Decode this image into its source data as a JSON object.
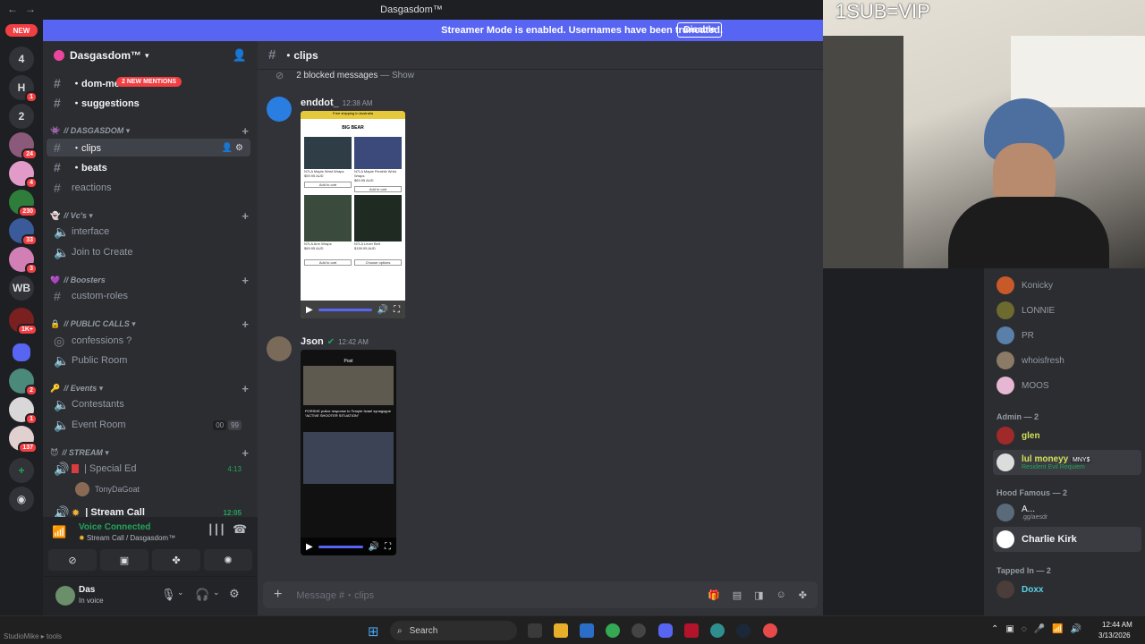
{
  "window": {
    "title": "Dasgasdom™"
  },
  "banner": {
    "text": "Streamer Mode is enabled. Usernames have been truncated.",
    "button": "Disable"
  },
  "rail": {
    "new_label": "NEW",
    "items": [
      {
        "label": "4"
      },
      {
        "label": "H",
        "badge": "1"
      },
      {
        "label": "2"
      },
      {
        "label": "",
        "badge": "24"
      },
      {
        "label": "",
        "badge": "4"
      },
      {
        "label": "",
        "badge": "230"
      },
      {
        "label": "",
        "badge": "33"
      },
      {
        "label": "",
        "badge": "3"
      },
      {
        "label": "WB"
      },
      {
        "label": "",
        "badge": "1K+"
      },
      {
        "label": ""
      },
      {
        "label": "",
        "badge": "2"
      },
      {
        "label": "",
        "badge": "1"
      },
      {
        "label": "",
        "badge": "137"
      }
    ]
  },
  "guild": {
    "name": "Dasgasdom™"
  },
  "channels": {
    "top": [
      {
        "name": "・dom-med"
      },
      {
        "name": "・suggestions"
      }
    ],
    "mention_pill": "2 NEW MENTIONS",
    "cat_dasgasdom": "// DASGASDOM",
    "dasgasdom": [
      {
        "name": "・clips"
      },
      {
        "name": "・beats"
      },
      {
        "name": "reactions"
      }
    ],
    "cat_vcs": "// Vc's",
    "vcs": [
      {
        "name": "interface"
      },
      {
        "name": "Join to Create"
      }
    ],
    "cat_boosters": "// Boosters",
    "boosters": [
      {
        "name": "custom-roles"
      }
    ],
    "cat_public": "// PUBLIC CALLS",
    "public": [
      {
        "name": "confessions ?"
      },
      {
        "name": "Public Room"
      }
    ],
    "cat_events": "// Events",
    "events": [
      {
        "name": "Contestants"
      },
      {
        "name": "Event Room",
        "counts": [
          "00",
          "99"
        ]
      }
    ],
    "cat_stream": "// STREAM",
    "stream": [
      {
        "name": "| Special Ed",
        "time": "4:13"
      },
      {
        "name": "TonyDaGoat"
      },
      {
        "name": "| Stream Call",
        "time": "12:05"
      }
    ]
  },
  "voice": {
    "status": "Voice Connected",
    "location": "Stream Call / Dasgasdom™"
  },
  "user": {
    "name": "Das",
    "status": "In voice"
  },
  "chat": {
    "channel": "・clips",
    "blocked": "2 blocked messages",
    "blocked_show": "— Show",
    "messages": [
      {
        "author": "enddot_",
        "time": "12:38 AM",
        "video_header": "Free shipping in Australia",
        "video_brand": "BIG BEAR",
        "products": [
          {
            "name": "N7LA Maple Wrist Wraps",
            "price": "$59.95 AUD",
            "btn": "Add to cart"
          },
          {
            "name": "N7LA Maple Flexible Wrist Wraps",
            "price": "$69.95 AUD",
            "btn": "Add to cart"
          },
          {
            "name": "N7LA Arm Wraps",
            "price": "$69.95 AUD",
            "btn": "Add to cart"
          },
          {
            "name": "N7LA Lever Belt",
            "price": "$159.95 AUD",
            "btn": "Choose options"
          }
        ]
      },
      {
        "author": "Json",
        "time": "12:42 AM",
        "video_header": "Post",
        "video_caption": "PORSHE police response to Temple Israel synagogue “ACTIVE SHOOTER SITUATION”"
      }
    ],
    "composer_placeholder": "Message #・clips"
  },
  "cam": {
    "overlay": "1SUB=VIP"
  },
  "members": {
    "online": [
      {
        "name": "Konicky"
      },
      {
        "name": "LONNIE"
      },
      {
        "name": "PR"
      },
      {
        "name": "whoisfresh"
      },
      {
        "name": "MOOS"
      }
    ],
    "admin_label": "Admin — 2",
    "admin": [
      {
        "name": "glen"
      },
      {
        "name": "lul moneyy",
        "tag": "MNY$",
        "activity": "Resident Evil Requiem"
      }
    ],
    "hood_label": "Hood Famous — 2",
    "hood": [
      {
        "name": "A...",
        "activity": ".gg/aesdr"
      },
      {
        "name": "Charlie Kirk"
      }
    ],
    "tapped_label": "Tapped In — 2",
    "tapped": [
      {
        "name": "Doxx"
      }
    ]
  },
  "taskbar": {
    "search": "Search",
    "time": "12:44 AM",
    "date": "3/13/2026",
    "watermark": "StudioMike ▸ tools"
  },
  "colors": {
    "blurple": "#5865f2",
    "red": "#f23f43",
    "green": "#23a55a"
  }
}
